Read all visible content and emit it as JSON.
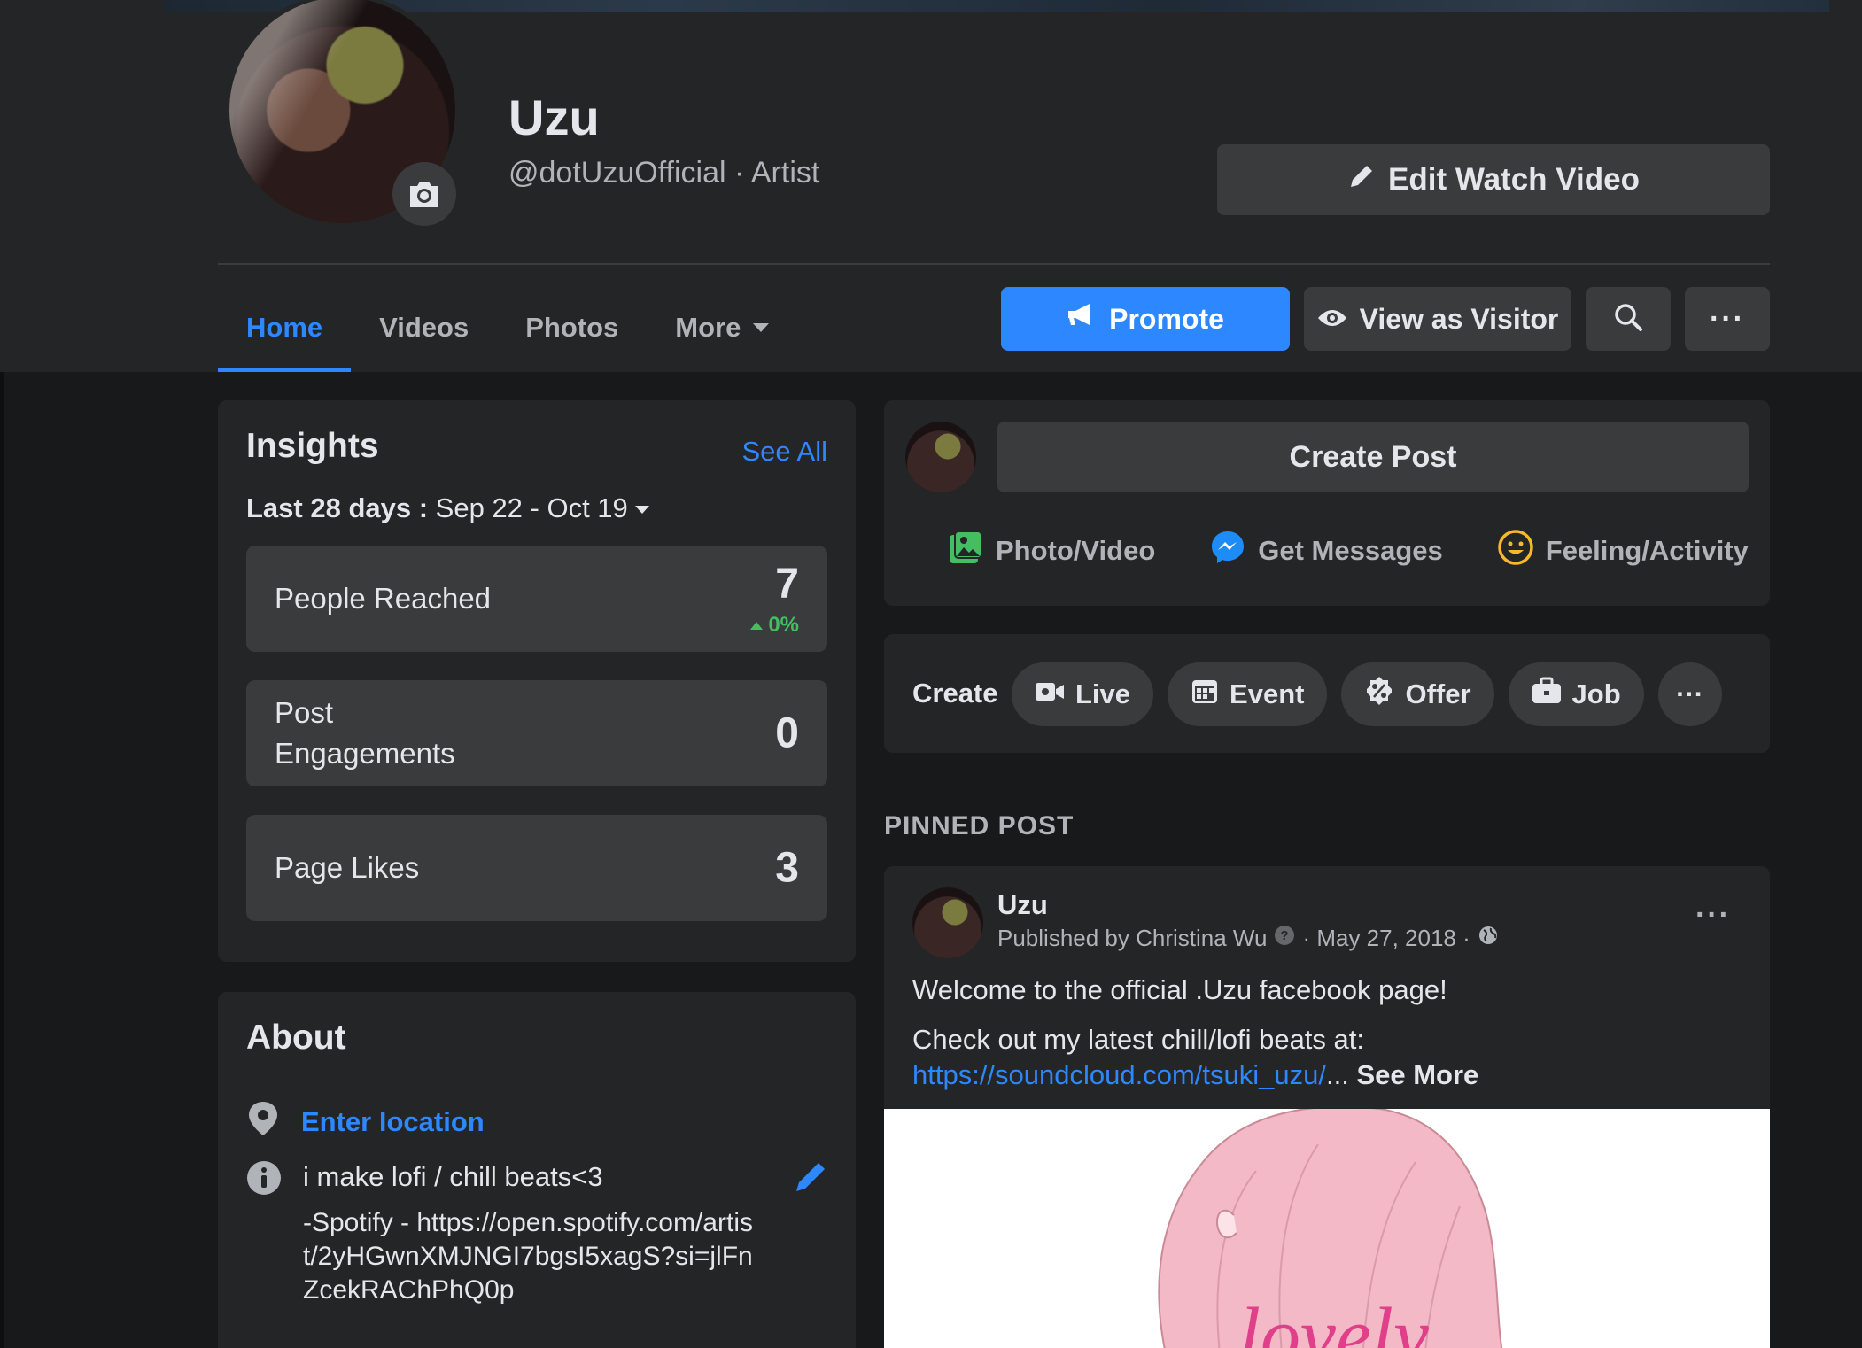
{
  "header": {
    "page_name": "Uzu",
    "handle": "@dotUzuOfficial · Artist",
    "edit_watch_label": "Edit Watch Video"
  },
  "tabs": [
    {
      "label": "Home",
      "active": true
    },
    {
      "label": "Videos",
      "active": false
    },
    {
      "label": "Photos",
      "active": false
    },
    {
      "label": "More",
      "active": false
    }
  ],
  "actions": {
    "promote_label": "Promote",
    "visitor_label": "View as Visitor",
    "more_label": "···"
  },
  "insights": {
    "title": "Insights",
    "see_all": "See All",
    "range_label": "Last 28 days :",
    "range_value": "Sep 22 - Oct 19",
    "stats": [
      {
        "label": "People Reached",
        "value": "7",
        "change": "0%"
      },
      {
        "label": "Post Engagements",
        "value": "0"
      },
      {
        "label": "Page Likes",
        "value": "3"
      }
    ]
  },
  "about": {
    "title": "About",
    "location_placeholder": "Enter location",
    "bio": "i make lofi / chill beats<3",
    "bio_more": "-Spotify - https://open.spotify.com/artist/2yHGwnXMJNGI7bgsI5xagS?si=jlFnZcekRAChPhQ0p"
  },
  "create_post": {
    "button_label": "Create Post",
    "actions": [
      {
        "label": "Photo/Video",
        "icon": "photo-icon"
      },
      {
        "label": "Get Messages",
        "icon": "messenger-icon"
      },
      {
        "label": "Feeling/Activity",
        "icon": "smiley-icon"
      }
    ]
  },
  "create_bar": {
    "label": "Create",
    "chips": [
      {
        "label": "Live",
        "icon": "video-camera-icon"
      },
      {
        "label": "Event",
        "icon": "calendar-icon"
      },
      {
        "label": "Offer",
        "icon": "percent-badge-icon"
      },
      {
        "label": "Job",
        "icon": "briefcase-icon"
      }
    ],
    "more_label": "···"
  },
  "pinned": {
    "section_label": "PINNED POST",
    "author": "Uzu",
    "published_by": "Published by Christina Wu",
    "date": "· May 27, 2018 ·",
    "line1": "Welcome to the official .Uzu facebook page!",
    "line2": "Check out my latest chill/lofi beats at:",
    "link": "https://soundcloud.com/tsuki_uzu/",
    "ellipsis": "...",
    "see_more": "See More",
    "image_text": "lovely",
    "more_label": "···"
  },
  "colors": {
    "accent": "#2d88ff",
    "background": "#18191a",
    "card": "#242526",
    "button": "#3a3b3c",
    "positive": "#45bd62"
  }
}
